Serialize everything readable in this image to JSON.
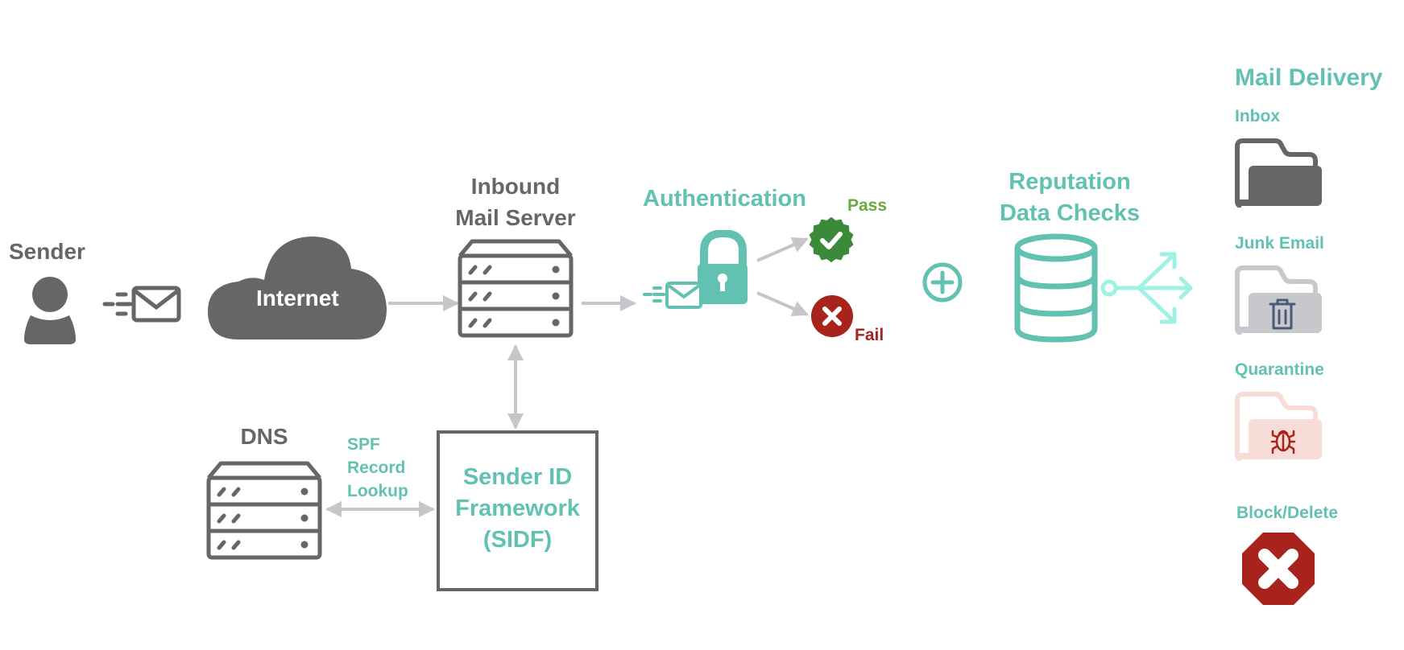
{
  "colors": {
    "gray": "#666666",
    "teal": "#62c1b1",
    "light_teal": "#9ef2e4",
    "arrow_gray": "#c6c6ca",
    "pass_green": "#3a8a3a",
    "pass_label_green": "#6aaa3a",
    "fail_red": "#a8231c",
    "junk_folder": "#c8c8cc",
    "junk_trash": "#4a5a7a",
    "quarantine_folder": "#f7dcd8"
  },
  "nodes": {
    "sender": {
      "label": "Sender",
      "icon": "user-icon"
    },
    "sent_mail": {
      "icon": "sent-mail-icon"
    },
    "internet": {
      "label": "Internet",
      "icon": "cloud-icon"
    },
    "inbound_server": {
      "label_line1": "Inbound",
      "label_line2": "Mail Server",
      "icon": "server-icon"
    },
    "dns": {
      "label": "DNS",
      "icon": "server-icon"
    },
    "spf_lookup": {
      "line1": "SPF",
      "line2": "Record",
      "line3": "Lookup"
    },
    "sidf": {
      "line1": "Sender ID",
      "line2": "Framework",
      "line3": "(SIDF)"
    },
    "authentication": {
      "label": "Authentication",
      "icon": "lock-mail-icon"
    },
    "pass": {
      "label": "Pass",
      "icon": "check-badge-icon"
    },
    "fail": {
      "label": "Fail",
      "icon": "x-circle-icon"
    },
    "plus": {
      "icon": "plus-circle-icon"
    },
    "reputation": {
      "label_line1": "Reputation",
      "label_line2": "Data Checks",
      "icon": "database-icon"
    },
    "split": {
      "icon": "split-arrows-icon"
    }
  },
  "delivery": {
    "title": "Mail Delivery",
    "options": [
      {
        "label": "Inbox",
        "icon": "folder-icon"
      },
      {
        "label": "Junk Email",
        "icon": "trash-folder-icon"
      },
      {
        "label": "Quarantine",
        "icon": "bug-folder-icon"
      },
      {
        "label": "Block/Delete",
        "icon": "stop-x-icon"
      }
    ]
  }
}
